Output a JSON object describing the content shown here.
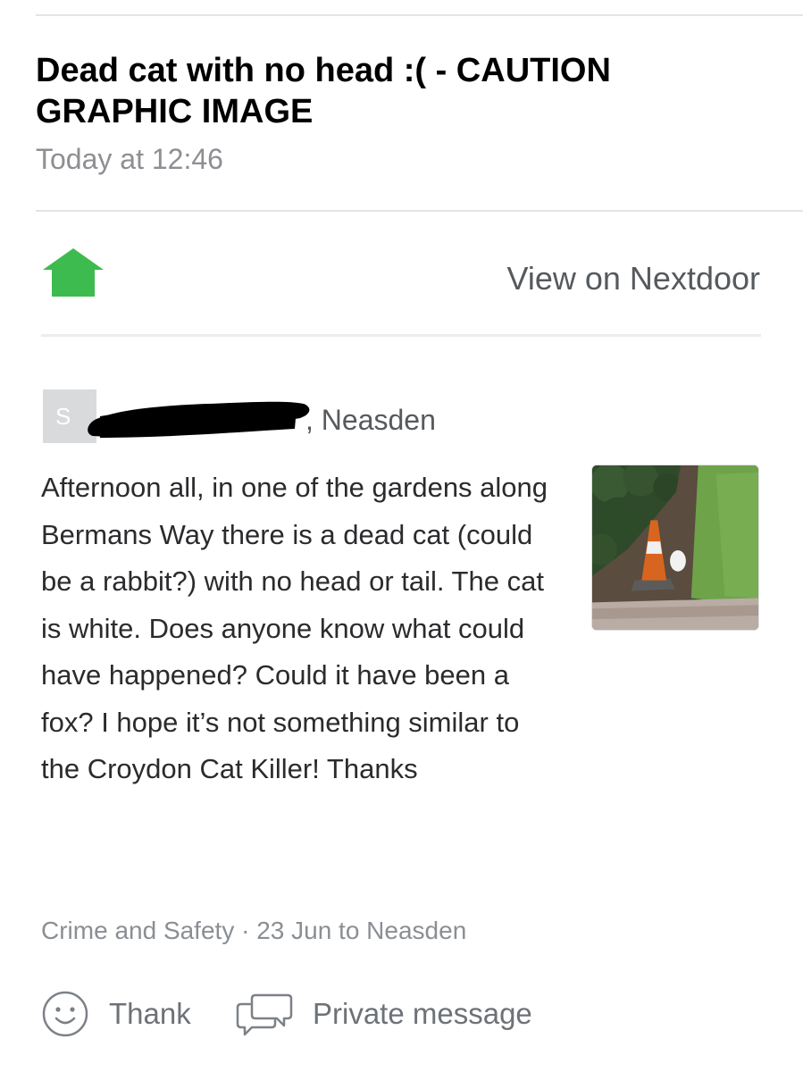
{
  "email": {
    "subject": "Dead cat with no head :( - CAUTION GRAPHIC IMAGE",
    "date": "Today at 12:46"
  },
  "header": {
    "logo_icon": "house-icon",
    "view_link": "View on Nextdoor",
    "brand_color": "#3dbb4f"
  },
  "post": {
    "avatar_initial": "S",
    "author_separator": ",",
    "location": "Neasden",
    "body": "Afternoon all, in one of the gardens along Bermans Way there is a dead cat (could be a rabbit?) with no head or tail. The cat is white. Does anyone know what could have happened? Could it have been a fox? I hope it’s not something similar to the Croydon Cat Killer! Thanks",
    "meta": "Crime and Safety · 23 Jun to Neasden"
  },
  "actions": {
    "thank_label": "Thank",
    "thank_icon": "smiley-icon",
    "private_message_label": "Private message",
    "private_message_icon": "chat-bubbles-icon"
  }
}
